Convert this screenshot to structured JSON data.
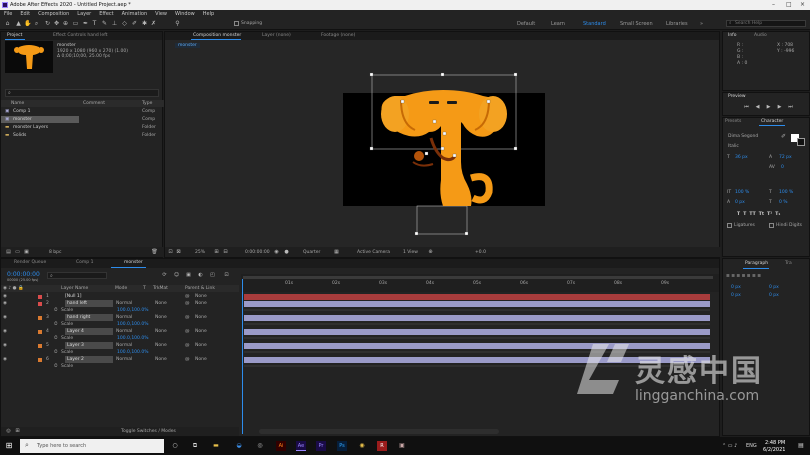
{
  "window": {
    "title": "Adobe After Effects 2020 - Untitled Project.aep *"
  },
  "menu": [
    "File",
    "Edit",
    "Composition",
    "Layer",
    "Effect",
    "Animation",
    "View",
    "Window",
    "Help"
  ],
  "toolbar": {
    "snapping": "Snapping",
    "workspaces": [
      "Default",
      "Learn",
      "Standard",
      "Small Screen",
      "Libraries"
    ],
    "active_workspace": "Standard",
    "search_placeholder": "Search Help"
  },
  "project_panel": {
    "tabs": [
      "Project",
      "Effect Controls  hand left"
    ],
    "item_name": "monster",
    "item_info1": "1920 x 1080  (960 x 270) (1.00)",
    "item_info2": "Δ 0;00;10;00, 25.00 fps",
    "columns": [
      "Name",
      "Comment",
      "Type"
    ],
    "items": [
      {
        "name": "Comp 1",
        "type": "Comp"
      },
      {
        "name": "monster",
        "type": "Comp"
      },
      {
        "name": "monster Layers",
        "type": "Folder"
      },
      {
        "name": "Solids",
        "type": "Folder"
      }
    ],
    "bpc": "8 bpc"
  },
  "viewer": {
    "tabs": [
      "Composition  monster",
      "Layer  (none)",
      "Footage  (none)"
    ],
    "breadcrumb": "monster",
    "zoom": "25%",
    "timecode": "0:00:00:00",
    "resolution": "Quarter",
    "camera": "Active Camera",
    "views": "1 View",
    "offset": "+0.0"
  },
  "right_panels": {
    "info_tabs": [
      "Info",
      "Audio"
    ],
    "info_values": [
      "R :",
      "G :",
      "B :",
      "A : 0",
      "X : 708",
      "Y : -996"
    ],
    "preview": "Preview",
    "presets": "Presets",
    "character": "Character",
    "font": "Dima Segond",
    "font_style": "Italic",
    "font_size": "36 px",
    "leading": "72 px",
    "tracking": "0",
    "scale_v": "100 %",
    "scale_h": "100 %",
    "baseline": "0 px",
    "tsume": "0 %",
    "ligatures": "Ligatures",
    "hindi": "Hindi Digits",
    "paragraph_tabs": [
      "Paragraph",
      "Tra"
    ],
    "para_values": [
      "0 px",
      "0 px",
      "0 px",
      "0 px"
    ]
  },
  "timeline": {
    "tabs": [
      "Render Queue",
      "Comp 1",
      "monster"
    ],
    "timecode": "0:00:00:00",
    "fps": "00000 (25.00 fps)",
    "columns": [
      "Layer Name",
      "Mode",
      "T",
      "TrkMat",
      "Parent & Link"
    ],
    "ruler": [
      "01s",
      "02s",
      "03s",
      "04s",
      "05s",
      "06s",
      "07s",
      "08s",
      "09s"
    ],
    "layers": [
      {
        "num": "1",
        "name": "[Null 1]",
        "mode": "",
        "trk": "",
        "parent": "None",
        "sub": ""
      },
      {
        "num": "2",
        "name": "hand left",
        "mode": "Normal",
        "trk": "None",
        "parent": "None",
        "sub": "Scale",
        "value": "100.0,100.0%"
      },
      {
        "num": "3",
        "name": "hand right",
        "mode": "Normal",
        "trk": "None",
        "parent": "None",
        "sub": "Scale",
        "value": "100.0,100.0%"
      },
      {
        "num": "4",
        "name": "Layer 4",
        "mode": "Normal",
        "trk": "None",
        "parent": "None",
        "sub": "Scale",
        "value": "100.0,100.0%"
      },
      {
        "num": "5",
        "name": "Layer 3",
        "mode": "Normal",
        "trk": "None",
        "parent": "None",
        "sub": "Scale",
        "value": "100.0,100.0%"
      },
      {
        "num": "6",
        "name": "Layer 2",
        "mode": "Normal",
        "trk": "None",
        "parent": "None",
        "sub": "Scale",
        "value": ""
      }
    ],
    "toggle": "Toggle Switches / Modes"
  },
  "taskbar": {
    "search_placeholder": "Type here to search",
    "time": "2:48 PM",
    "date": "6/2/2021",
    "lang": "ENG"
  },
  "watermark": {
    "cn": "灵感中国",
    "url": "lingganchina.com"
  },
  "colors": {
    "accent": "#2d8ceb",
    "monster": "#f59a16",
    "red_track": "#a83c3c",
    "purple_track": "#9a9ac8"
  }
}
